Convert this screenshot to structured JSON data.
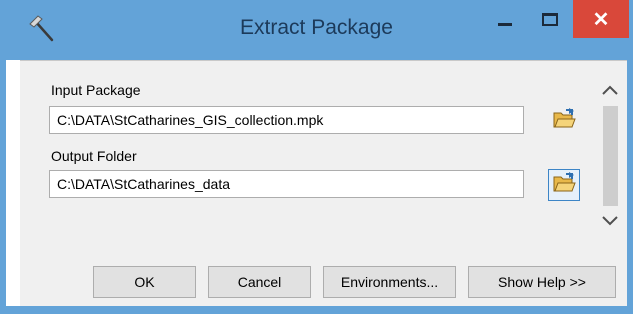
{
  "window": {
    "title": "Extract Package",
    "close_glyph": "✕",
    "app_icon": "hammer-icon",
    "colors": {
      "frame": "#63a3d8",
      "close": "#d9483a",
      "focus_border": "#3d85c6"
    }
  },
  "form": {
    "input_package": {
      "label": "Input Package",
      "value": "C:\\DATA\\StCatharines_GIS_collection.mpk",
      "browse_icon": "folder-open-icon"
    },
    "output_folder": {
      "label": "Output Folder",
      "value": "C:\\DATA\\StCatharines_data",
      "browse_icon": "folder-open-icon"
    }
  },
  "buttons": {
    "ok": "OK",
    "cancel": "Cancel",
    "environments": "Environments...",
    "show_help": "Show Help >>"
  }
}
